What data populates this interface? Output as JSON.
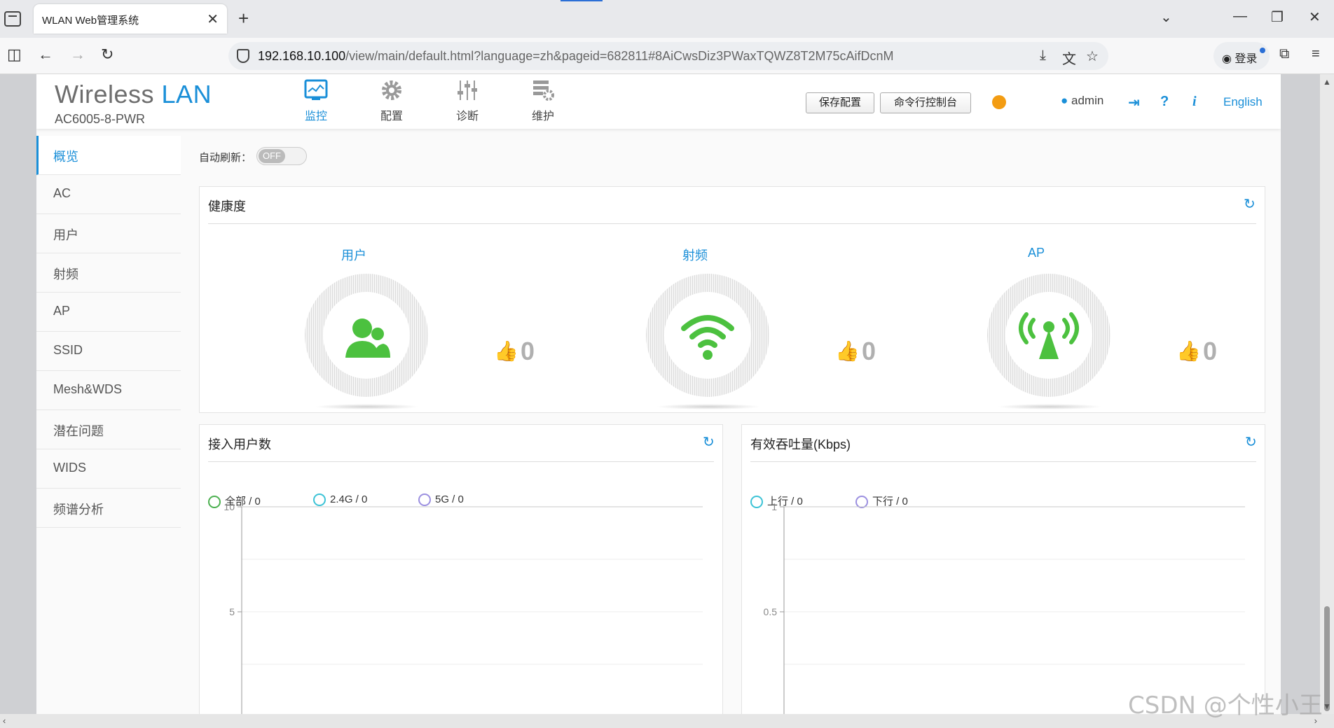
{
  "browser": {
    "tab_title": "WLAN Web管理系统",
    "tab_close": "✕",
    "new_tab": "+",
    "url_host": "192.168.10.100",
    "url_path": "/view/main/default.html?language=zh&pageid=682811#8AiCwsDiz3PWaxTQWZ8T2M75cAifDcnM",
    "login_label": "登录"
  },
  "header": {
    "logo_wireless": "Wireless",
    "logo_lan": "LAN",
    "model": "AC6005-8-PWR",
    "nav": [
      {
        "label": "监控",
        "icon": "monitor-icon",
        "active": true
      },
      {
        "label": "配置",
        "icon": "gear-icon",
        "active": false
      },
      {
        "label": "诊断",
        "icon": "sliders-icon",
        "active": false
      },
      {
        "label": "维护",
        "icon": "maintenance-icon",
        "active": false
      }
    ],
    "save_config": "保存配置",
    "cli_console": "命令行控制台",
    "user": "admin",
    "language": "English"
  },
  "sidebar": {
    "items": [
      {
        "label": "概览",
        "active": true
      },
      {
        "label": "AC"
      },
      {
        "label": "用户"
      },
      {
        "label": "射频"
      },
      {
        "label": "AP"
      },
      {
        "label": "SSID"
      },
      {
        "label": "Mesh&WDS"
      },
      {
        "label": "潜在问题"
      },
      {
        "label": "WIDS"
      },
      {
        "label": "频谱分析"
      }
    ]
  },
  "auto_refresh": {
    "label": "自动刷新：",
    "state": "OFF"
  },
  "health": {
    "title": "健康度",
    "items": [
      {
        "label": "用户",
        "score": "0",
        "icon": "users-icon"
      },
      {
        "label": "射频",
        "score": "0",
        "icon": "wifi-icon"
      },
      {
        "label": "AP",
        "score": "0",
        "icon": "ap-antenna-icon"
      }
    ],
    "accent": "#4cc13f"
  },
  "users_panel": {
    "title": "接入用户数",
    "legend": [
      {
        "label": "全部 / 0",
        "color": "#4cb050"
      },
      {
        "label": "2.4G / 0",
        "color": "#3cc3d6"
      },
      {
        "label": "5G / 0",
        "color": "#9b8fe0"
      }
    ]
  },
  "throughput_panel": {
    "title": "有效吞吐量(Kbps)",
    "legend": [
      {
        "label": "上行 / 0",
        "color": "#3cc3d6"
      },
      {
        "label": "下行 / 0",
        "color": "#9b8fe0"
      }
    ]
  },
  "chart_data": [
    {
      "type": "line",
      "title": "接入用户数",
      "series": [
        {
          "name": "全部",
          "values": []
        },
        {
          "name": "2.4G",
          "values": []
        },
        {
          "name": "5G",
          "values": []
        }
      ],
      "yticks": [
        "10",
        "5"
      ],
      "ylim": [
        0,
        10
      ],
      "grid": true,
      "legend": "top-left"
    },
    {
      "type": "line",
      "title": "有效吞吐量(Kbps)",
      "series": [
        {
          "name": "上行",
          "values": []
        },
        {
          "name": "下行",
          "values": []
        }
      ],
      "yticks": [
        "1",
        "0.5"
      ],
      "ylim": [
        0,
        1
      ],
      "grid": true,
      "legend": "top-left"
    }
  ],
  "watermark": "CSDN @个性小王"
}
